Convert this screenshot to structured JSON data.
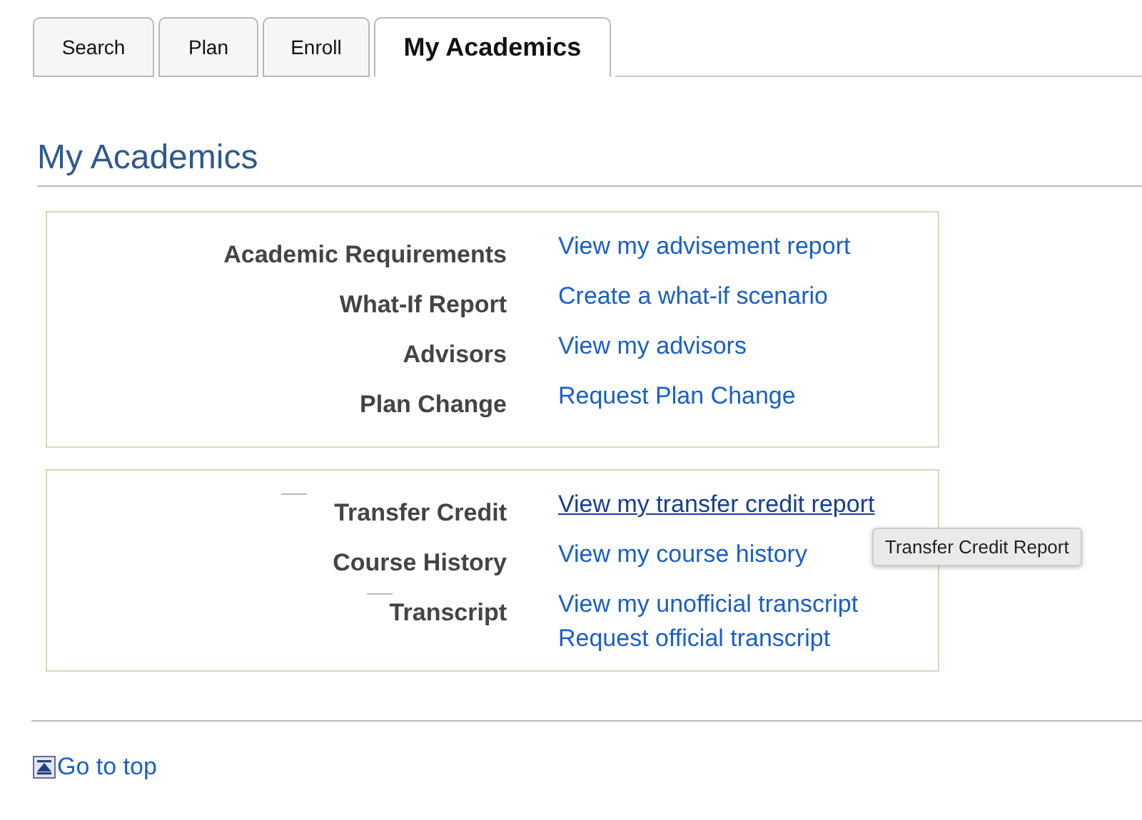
{
  "tabs": [
    {
      "label": "Search",
      "selected": false
    },
    {
      "label": "Plan",
      "selected": false
    },
    {
      "label": "Enroll",
      "selected": false
    },
    {
      "label": "My Academics",
      "selected": true
    }
  ],
  "heading": "My Academics",
  "sections": [
    {
      "rows": [
        {
          "label": "Academic Requirements",
          "links": [
            {
              "text": "View my advisement report",
              "hovered": false
            }
          ]
        },
        {
          "label": "What-If Report",
          "links": [
            {
              "text": "Create a what-if scenario",
              "hovered": false
            }
          ]
        },
        {
          "label": "Advisors",
          "links": [
            {
              "text": "View my advisors",
              "hovered": false
            }
          ]
        },
        {
          "label": "Plan Change",
          "links": [
            {
              "text": "Request Plan Change",
              "hovered": false
            }
          ]
        }
      ]
    },
    {
      "rows": [
        {
          "label": "Transfer Credit",
          "links": [
            {
              "text": "View my transfer credit report",
              "hovered": true
            }
          ]
        },
        {
          "label": "Course History",
          "links": [
            {
              "text": "View my course history",
              "hovered": false
            }
          ]
        },
        {
          "label": "Transcript",
          "links": [
            {
              "text": "View my unofficial transcript",
              "hovered": false
            },
            {
              "text": "Request official transcript",
              "hovered": false
            }
          ]
        }
      ]
    }
  ],
  "tooltip": "Transfer Credit Report",
  "go_to_top": "Go to top"
}
